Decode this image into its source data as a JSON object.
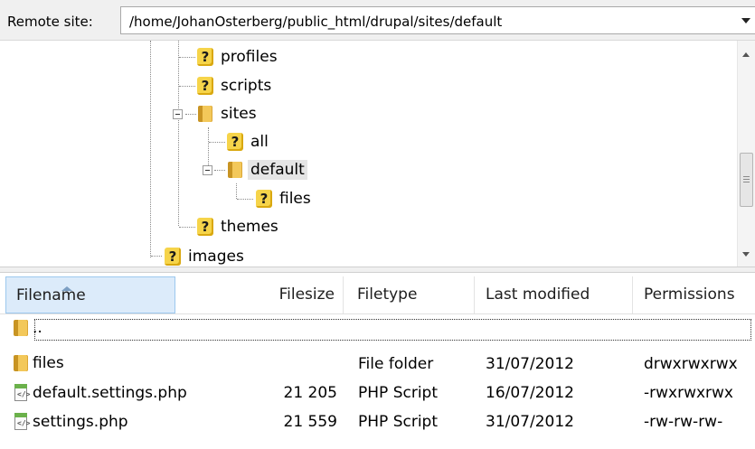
{
  "site_bar": {
    "label": "Remote site:",
    "path": "/home/JohanOsterberg/public_html/drupal/sites/default"
  },
  "tree": {
    "nodes": [
      {
        "label": "profiles",
        "icon": "question-icon"
      },
      {
        "label": "scripts",
        "icon": "question-icon"
      },
      {
        "label": "sites",
        "icon": "folder-icon",
        "expanded": true
      },
      {
        "label": "all",
        "icon": "question-icon"
      },
      {
        "label": "default",
        "icon": "folder-icon",
        "expanded": true,
        "selected": true
      },
      {
        "label": "files",
        "icon": "question-icon"
      },
      {
        "label": "themes",
        "icon": "question-icon"
      },
      {
        "label": "images",
        "icon": "question-icon"
      }
    ]
  },
  "list": {
    "columns": {
      "filename": "Filename",
      "filesize": "Filesize",
      "filetype": "Filetype",
      "modified": "Last modified",
      "permissions": "Permissions"
    },
    "rows": [
      {
        "name": "..",
        "size": "",
        "type": "",
        "modified": "",
        "perms": "",
        "icon": "folder-icon"
      },
      {
        "name": "files",
        "size": "",
        "type": "File folder",
        "modified": "31/07/2012",
        "perms": "drwxrwxrwx",
        "icon": "folder-icon"
      },
      {
        "name": "default.settings.php",
        "size": "21 205",
        "type": "PHP Script",
        "modified": "16/07/2012",
        "perms": "-rwxrwxrwx",
        "icon": "php-file-icon"
      },
      {
        "name": "settings.php",
        "size": "21 559",
        "type": "PHP Script",
        "modified": "31/07/2012",
        "perms": "-rw-rw-rw-",
        "icon": "php-file-icon"
      }
    ]
  }
}
